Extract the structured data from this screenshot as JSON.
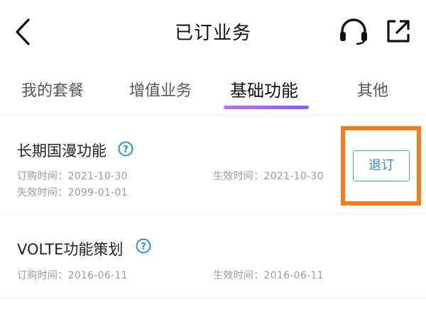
{
  "header": {
    "title": "已订业务",
    "back_icon": "chevron-left-icon",
    "headset_icon": "headset-icon",
    "share_icon": "external-link-icon"
  },
  "tabs": [
    {
      "label": "我的套餐",
      "active": false
    },
    {
      "label": "增值业务",
      "active": false
    },
    {
      "label": "基础功能",
      "active": true
    },
    {
      "label": "其他",
      "active": false
    }
  ],
  "services": [
    {
      "name": "长期国漫功能",
      "order_time": "订购时间：2021-10-30",
      "effective_time": "生效时间：2021-10-30",
      "expire_time": "失效时间：2099-01-01",
      "action_label": "退订"
    },
    {
      "name": "VOLTE功能策划",
      "order_time": "订购时间：2016-06-11",
      "effective_time": "生效时间：2016-06-11"
    }
  ],
  "colors": {
    "accent_blue": "#2f8fdc",
    "tab_indicator_start": "#c86af0",
    "tab_indicator_end": "#8a5cf0",
    "highlight_orange": "#f47a1f"
  }
}
